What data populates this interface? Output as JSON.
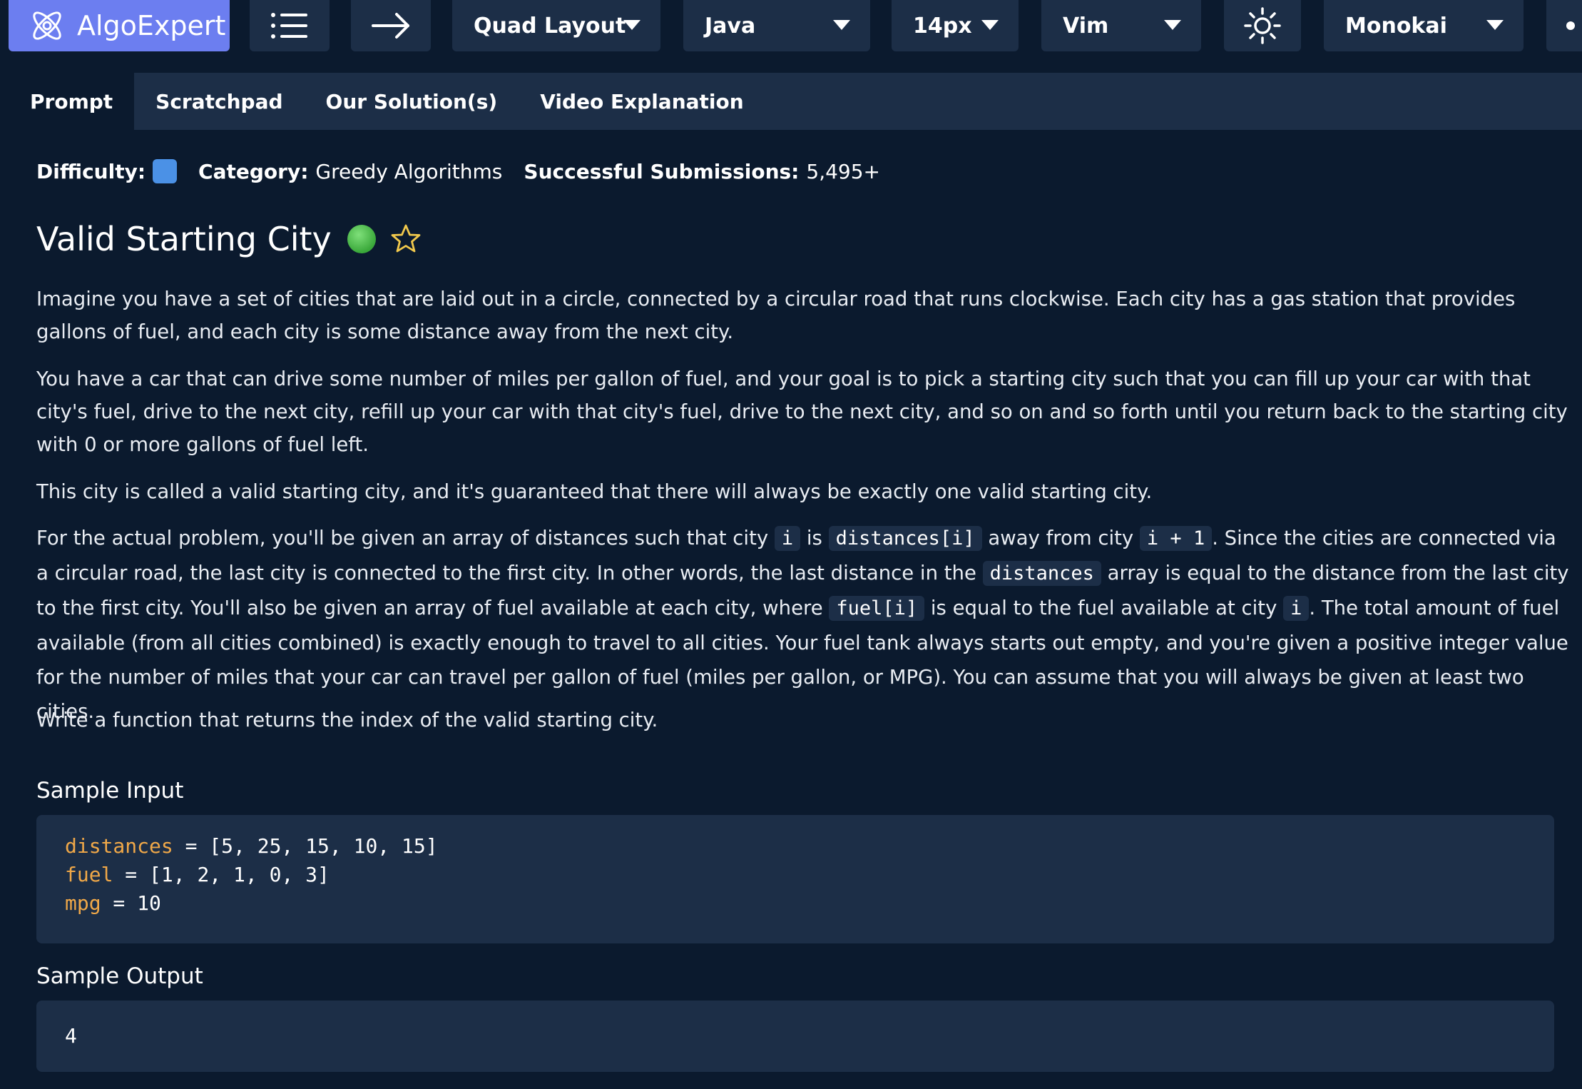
{
  "app": {
    "name": "AlgoExpert"
  },
  "toolbar": {
    "layout": "Quad Layout",
    "language": "Java",
    "font_size": "14px",
    "keymap": "Vim",
    "theme": "Monokai"
  },
  "tabs": [
    {
      "label": "Prompt",
      "active": true
    },
    {
      "label": "Scratchpad",
      "active": false
    },
    {
      "label": "Our Solution(s)",
      "active": false
    },
    {
      "label": "Video Explanation",
      "active": false
    }
  ],
  "meta": {
    "difficulty_label": "Difficulty:",
    "category_label": "Category:",
    "category_value": "Greedy Algorithms",
    "submissions_label": "Successful Submissions:",
    "submissions_value": "5,495+"
  },
  "problem": {
    "title": "Valid Starting City",
    "p1": "Imagine you have a set of cities that are laid out in a circle, connected by a circular road that runs clockwise. Each city has a gas station that provides gallons of fuel, and each city is some distance away from the next city.",
    "p2": "You have a car that can drive some number of miles per gallon of fuel, and your goal is to pick a starting city such that you can fill up your car with that city's fuel, drive to the next city, refill up your car with that city's fuel, drive to the next city, and so on and so forth until you return back to the starting city with 0 or more gallons of fuel left.",
    "p3": "This city is called a valid starting city, and it's guaranteed that there will always be exactly one valid starting city.",
    "p4": {
      "t1": "For the actual problem, you'll be given an array of distances such that city ",
      "c1": "i",
      "t2": " is ",
      "c2": "distances[i]",
      "t3": " away from city ",
      "c3": "i + 1",
      "t4": ". Since the cities are connected via a circular road, the last city is connected to the first city. In other words, the last distance in the ",
      "c4": "distances",
      "t5": " array is equal to the distance from the last city to the first city. You'll also be given an array of fuel available at each city, where ",
      "c5": "fuel[i]",
      "t6": " is equal to the fuel available at city ",
      "c6": "i",
      "t7": ". The total amount of fuel available (from all cities combined) is exactly enough to travel to all cities. Your fuel tank always starts out empty, and you're given a positive integer value for the number of miles that your car can travel per gallon of fuel (miles per gallon, or MPG). You can assume that you will always be given at least two cities."
    },
    "p5": "Write a function that returns the index of the valid starting city."
  },
  "sample_input": {
    "title": "Sample Input",
    "lines": [
      {
        "name": "distances",
        "rest": " = [5, 25, 15, 10, 15]"
      },
      {
        "name": "fuel",
        "rest": " = [1, 2, 1, 0, 3]"
      },
      {
        "name": "mpg",
        "rest": " = 10"
      }
    ]
  },
  "sample_output": {
    "title": "Sample Output",
    "value": "4"
  },
  "colors": {
    "logo_bg": "#6c7ef0",
    "toolbar_bg": "#1c2e47",
    "page_bg": "#0b1a2e",
    "difficulty": "#4b91e6",
    "code_keyword": "#f0a848"
  }
}
